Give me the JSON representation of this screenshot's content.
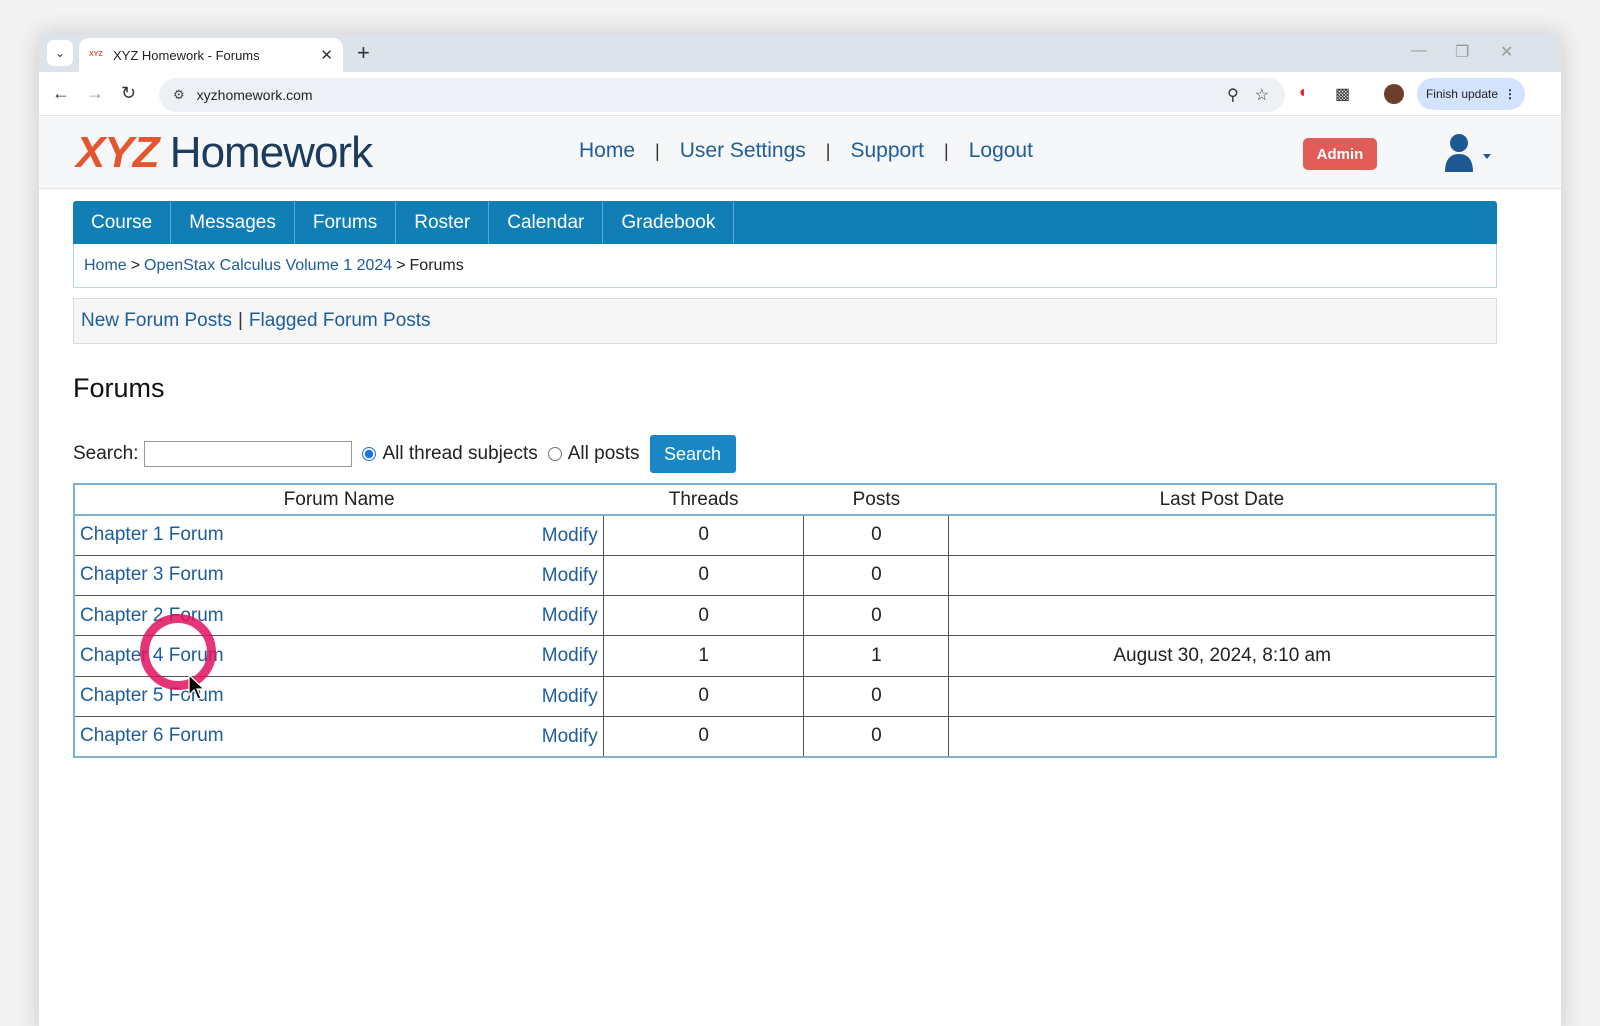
{
  "browser": {
    "tab_title": "XYZ Homework - Forums",
    "tab_favicon_text": "XYZ",
    "url": "xyzhomework.com",
    "finish_update": "Finish update"
  },
  "site": {
    "logo_xyz": "XYZ",
    "logo_rest": " Homework",
    "topnav": [
      "Home",
      "User Settings",
      "Support",
      "Logout"
    ],
    "admin_label": "Admin"
  },
  "mainnav": [
    "Course",
    "Messages",
    "Forums",
    "Roster",
    "Calendar",
    "Gradebook"
  ],
  "breadcrumb": {
    "home": "Home",
    "sep": ">",
    "course": "OpenStax Calculus Volume 1 2024",
    "current": "Forums"
  },
  "subnav": {
    "new_posts": "New Forum Posts",
    "sep": "|",
    "flagged_posts": "Flagged Forum Posts"
  },
  "page_title": "Forums",
  "search": {
    "label": "Search:",
    "value": "",
    "option_subjects": "All thread subjects",
    "option_posts": "All posts",
    "button": "Search"
  },
  "table": {
    "headers": [
      "Forum Name",
      "Threads",
      "Posts",
      "Last Post Date"
    ],
    "modify_label": "Modify",
    "rows": [
      {
        "name": "Chapter 1 Forum",
        "threads": "0",
        "posts": "0",
        "last": ""
      },
      {
        "name": "Chapter 3 Forum",
        "threads": "0",
        "posts": "0",
        "last": ""
      },
      {
        "name": "Chapter 2 Forum",
        "threads": "0",
        "posts": "0",
        "last": ""
      },
      {
        "name": "Chapter 4 Forum",
        "threads": "1",
        "posts": "1",
        "last": "August 30, 2024, 8:10 am"
      },
      {
        "name": "Chapter 5 Forum",
        "threads": "0",
        "posts": "0",
        "last": ""
      },
      {
        "name": "Chapter 6 Forum",
        "threads": "0",
        "posts": "0",
        "last": ""
      }
    ]
  },
  "colors": {
    "nav_blue": "#127eb6",
    "link": "#1e5d99",
    "logo_orange": "#e4572e",
    "admin_red": "#e25c57",
    "click_ring": "#e0105f"
  }
}
